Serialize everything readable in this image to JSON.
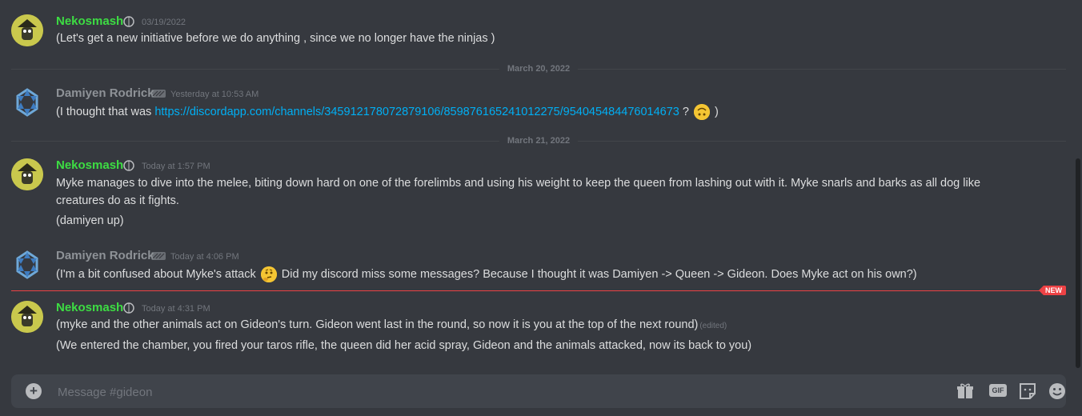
{
  "messages": [
    {
      "author": "Nekosmash",
      "timestamp": "03/19/2022",
      "lines": [
        "(Let's get a new initiative before we do anything , since we no longer have the ninjas )"
      ]
    },
    {
      "author": "Damiyen Rodrick",
      "timestamp": "Yesterday at 10:53 AM",
      "text_before_link": "(I thought that was ",
      "link": "https://discordapp.com/channels/345912178072879106/859876165241012275/954045484476014673",
      "text_after_link": " ?",
      "emoji": "upside-down-face",
      "text_end": " )"
    },
    {
      "author": "Nekosmash",
      "timestamp": "Today at 1:57 PM",
      "lines": [
        "Myke manages to dive into the melee, biting down hard on one of the forelimbs and using his weight to keep the queen from lashing out with it. Myke snarls and  barks as all dog like creatures do as it fights.",
        "(damiyen up)"
      ]
    },
    {
      "author": "Damiyen Rodrick",
      "timestamp": "Today at 4:06 PM",
      "text_before_emoji": "(I'm a bit confused about Myke's attack ",
      "emoji": "thinking-face",
      "text_after_emoji": " Did my discord miss some messages?  Because I thought it was Damiyen -> Queen -> Gideon.  Does Myke act on his own?)"
    },
    {
      "author": "Nekosmash",
      "timestamp": "Today at 4:31 PM",
      "lines": [
        "(myke and the other animals act on Gideon's turn. Gideon went last in the round, so now it is you at the top of the next round)",
        "(We entered the chamber, you fired your taros rifle, the queen did her acid spray, Gideon and the animals attacked, now its back to you)"
      ],
      "edited_label": "(edited)"
    }
  ],
  "dividers": [
    "March 20, 2022",
    "March 21, 2022"
  ],
  "new_label": "NEW",
  "composer": {
    "placeholder": "Message #gideon",
    "icons": [
      "add-attachment-icon",
      "gift-icon",
      "gif-icon",
      "sticker-icon",
      "emoji-icon"
    ],
    "gif_label": "GIF"
  },
  "colors": {
    "background": "#36393f",
    "neko_name": "#3ddd43",
    "damiyen_name": "#8e9297",
    "link": "#00aff4",
    "new_divider": "#ed4245",
    "composer": "#40444b"
  }
}
